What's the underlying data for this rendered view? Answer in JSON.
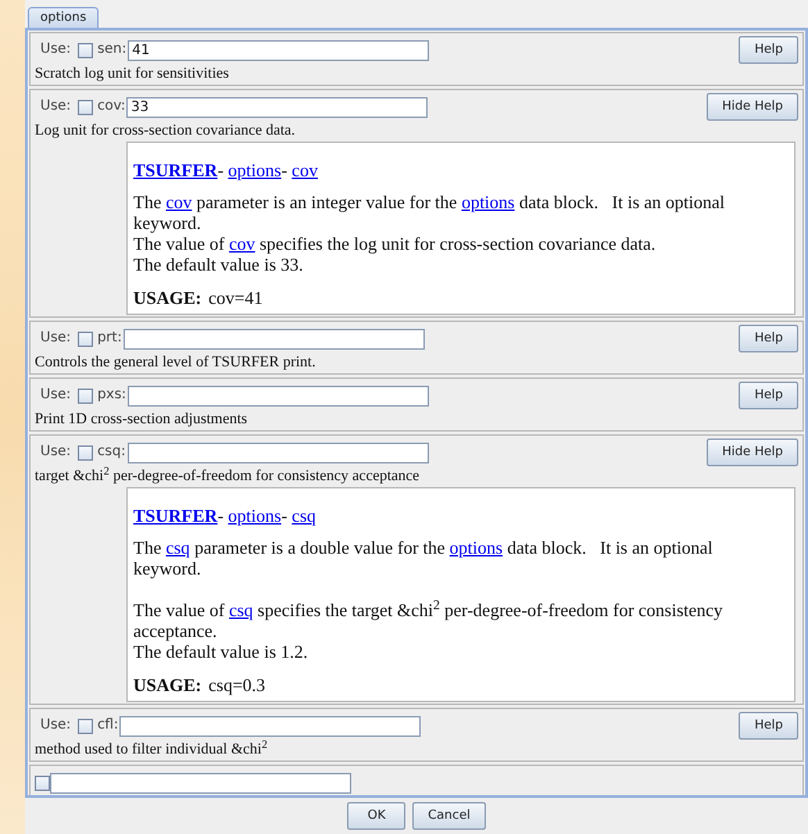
{
  "tabs": [
    {
      "label": "options",
      "selected": true
    }
  ],
  "options": [
    {
      "use_label": "Use:",
      "checked": false,
      "name": "sen:",
      "value": "41",
      "button": "Help",
      "description": "Scratch log unit for sensitivities"
    },
    {
      "use_label": "Use:",
      "checked": false,
      "name": "cov:",
      "value": "33",
      "button": "Hide Help",
      "description": "Log unit for cross-section covariance data.",
      "help": {
        "breadcrumb": [
          {
            "text": "TSURFER",
            "kind": "root"
          },
          {
            "text": "- ",
            "kind": "plain"
          },
          {
            "text": "options",
            "kind": "link"
          },
          {
            "text": "- ",
            "kind": "plain"
          },
          {
            "text": "cov",
            "kind": "link"
          }
        ],
        "paragraphs": [
          {
            "gap_before": false,
            "segments": [
              {
                "text": "The ",
                "kind": "plain"
              },
              {
                "text": "cov",
                "kind": "link"
              },
              {
                "text": " parameter is an integer value for the ",
                "kind": "plain"
              },
              {
                "text": "options",
                "kind": "link"
              },
              {
                "text": " data block.   It is an optional keyword.",
                "kind": "plain"
              }
            ]
          },
          {
            "gap_before": false,
            "segments": [
              {
                "text": "The value of ",
                "kind": "plain"
              },
              {
                "text": "cov",
                "kind": "link"
              },
              {
                "text": " specifies the log unit for cross-section covariance data.",
                "kind": "plain"
              }
            ]
          },
          {
            "gap_before": false,
            "segments": [
              {
                "text": "The default value is 33.",
                "kind": "plain"
              }
            ]
          }
        ],
        "usage_label": "USAGE:",
        "usage": "cov=41"
      }
    },
    {
      "use_label": "Use:",
      "checked": false,
      "name": "prt:",
      "button": "Help",
      "description": "Controls the general level of TSURFER print."
    },
    {
      "use_label": "Use:",
      "checked": false,
      "name": "pxs:",
      "button": "Help",
      "description": "Print 1D cross-section adjustments"
    },
    {
      "use_label": "Use:",
      "checked": false,
      "name": "csq:",
      "button": "Hide Help",
      "description": "target &chi$^{2}$ per-degree-of-freedom for consistency acceptance",
      "help": {
        "breadcrumb": [
          {
            "text": "TSURFER",
            "kind": "root"
          },
          {
            "text": "- ",
            "kind": "plain"
          },
          {
            "text": "options",
            "kind": "link"
          },
          {
            "text": "- ",
            "kind": "plain"
          },
          {
            "text": "csq",
            "kind": "link"
          }
        ],
        "paragraphs": [
          {
            "gap_before": false,
            "segments": [
              {
                "text": "The ",
                "kind": "plain"
              },
              {
                "text": "csq",
                "kind": "link"
              },
              {
                "text": " parameter is a double value for the ",
                "kind": "plain"
              },
              {
                "text": "options",
                "kind": "link"
              },
              {
                "text": " data block.   It is an optional keyword.",
                "kind": "plain"
              }
            ]
          },
          {
            "gap_before": true,
            "segments": [
              {
                "text": "The value of ",
                "kind": "plain"
              },
              {
                "text": "csq",
                "kind": "link"
              },
              {
                "text": " specifies the target &chi$^{2}$ per-degree-of-freedom for consistency acceptance.",
                "kind": "plain"
              }
            ]
          },
          {
            "gap_before": false,
            "segments": [
              {
                "text": "The default value is 1.2.",
                "kind": "plain"
              }
            ]
          }
        ],
        "usage_label": "USAGE:",
        "usage": "csq=0.3"
      }
    },
    {
      "use_label": "Use:",
      "checked": false,
      "name": "cfl:",
      "button": "Help",
      "description": "method used to filter individual &chi$^{2}$"
    },
    {
      "checked": false
    }
  ],
  "buttons": [
    "OK",
    "Cancel"
  ]
}
